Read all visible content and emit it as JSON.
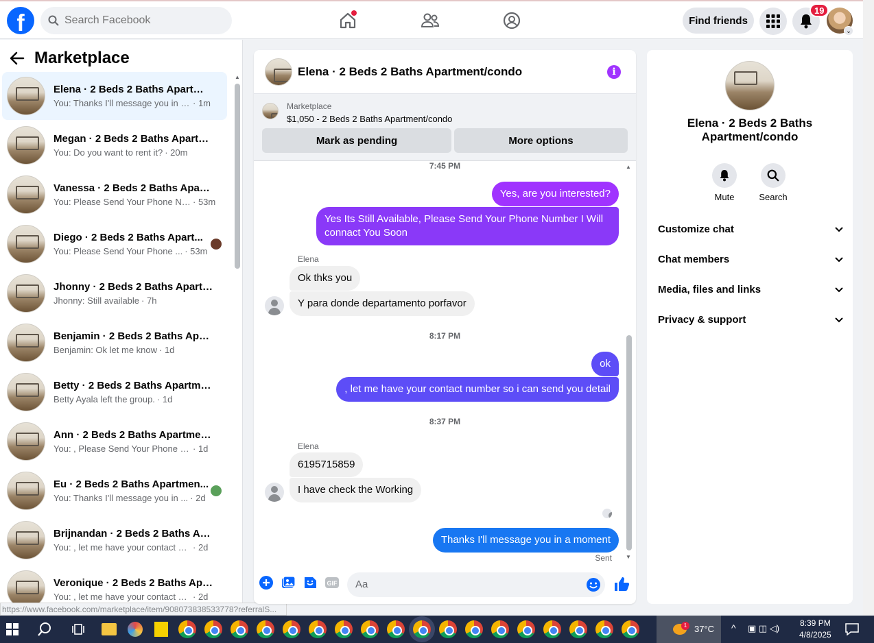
{
  "topbar": {
    "search_placeholder": "Search Facebook",
    "find_friends": "Find friends",
    "notification_count": "19"
  },
  "left": {
    "title": "Marketplace",
    "conversations": [
      {
        "name": "Elena · 2 Beds 2 Baths Apartmen...",
        "preview": "You: Thanks I'll message you in a ...",
        "time": "· 1m",
        "active": true
      },
      {
        "name": "Megan · 2 Beds 2 Baths Apartm...",
        "preview": "You: Do you want to rent it?",
        "time": "· 20m"
      },
      {
        "name": "Vanessa · 2 Beds 2 Baths Apartm...",
        "preview": "You: Please Send Your Phone Nu...",
        "time": "· 53m"
      },
      {
        "name": "Diego · 2 Beds 2 Baths Apart...",
        "preview": "You: Please Send Your Phone ...",
        "time": "· 53m"
      },
      {
        "name": "Jhonny · 2 Beds 2 Baths Apartm...",
        "preview": "Jhonny: Still available",
        "time": "· 7h"
      },
      {
        "name": "Benjamin · 2 Beds 2 Baths Apart...",
        "preview": "Benjamin: Ok let me know",
        "time": "· 1d"
      },
      {
        "name": "Betty · 2 Beds 2 Baths Apartmen...",
        "preview": "Betty Ayala left the group.",
        "time": "· 1d"
      },
      {
        "name": "Ann · 2 Beds 2 Baths Apartment...",
        "preview": "You: , Please Send Your Phone Num...",
        "time": "· 1d"
      },
      {
        "name": "Eu · 2 Beds 2 Baths Apartmen...",
        "preview": "You: Thanks I'll message you in ...",
        "time": "· 2d"
      },
      {
        "name": "Brijnandan · 2 Beds 2 Baths Apa...",
        "preview": "You: , let me have your contact nu...",
        "time": "· 2d"
      },
      {
        "name": "Veronique · 2 Beds 2 Baths Apar...",
        "preview": "You: , let me have your contact nu...",
        "time": "· 2d"
      }
    ],
    "status_url": "https://www.facebook.com/marketplace/item/908073838533778?referralS..."
  },
  "chat": {
    "title": "Elena · 2 Beds 2 Baths Apartment/condo",
    "marketplace_label": "Marketplace",
    "listing": "$1,050 - 2 Beds 2 Baths Apartment/condo",
    "mark_pending": "Mark as pending",
    "more_options": "More options",
    "ts1": "7:45 PM",
    "m1": "Yes, are you interested?",
    "m2": "Yes Its Still Available, Please Send Your Phone Number I Will connact You Soon",
    "sender1": "Elena",
    "m3": "Ok thks you",
    "m4": "Y para donde  departamento porfavor",
    "ts2": "8:17 PM",
    "m5": "ok",
    "m6": ", let me have your contact number so i can send you detail",
    "ts3": "8:37 PM",
    "sender2": "Elena",
    "m7": "6195715859",
    "m8": "I have check the Working",
    "m9": "Thanks I'll message you in a moment",
    "sent": "Sent",
    "input_placeholder": "Aa"
  },
  "right": {
    "name": "Elena · 2 Beds 2 Baths Apartment/condo",
    "mute": "Mute",
    "search": "Search",
    "sections": [
      "Customize chat",
      "Chat members",
      "Media, files and links",
      "Privacy & support"
    ]
  },
  "taskbar": {
    "temp": "37°C",
    "time": "8:39 PM",
    "date": "4/8/2025",
    "weather_badge": "1"
  }
}
